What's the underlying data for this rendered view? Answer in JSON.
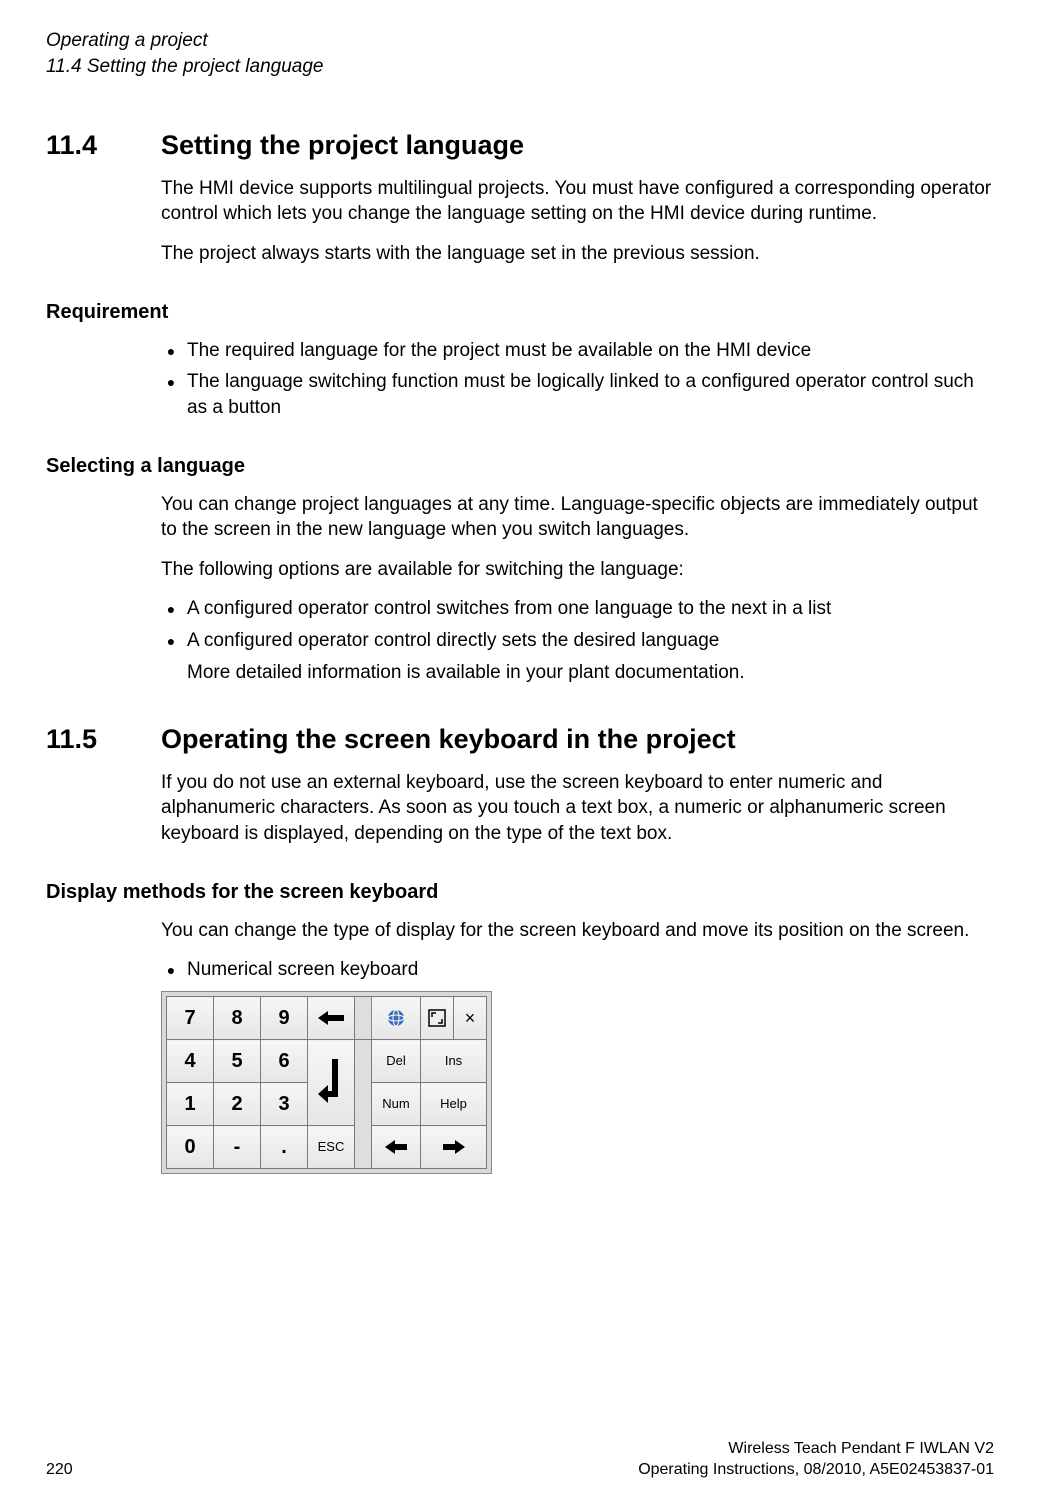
{
  "header": {
    "line1": "Operating a project",
    "line2": "11.4 Setting the project language"
  },
  "s114": {
    "num": "11.4",
    "title": "Setting the project language",
    "intro1": "The HMI device supports multilingual projects. You must have configured a corresponding operator control which lets you change the language setting on the HMI device during runtime.",
    "intro2": "The project always starts with the language set in the previous session.",
    "req_h": "Requirement",
    "req1": "The required language for the project must be available on the HMI device",
    "req2": "The language switching function must be logically linked to a configured operator control such as a button",
    "sel_h": "Selecting a language",
    "sel1": "You can change project languages at any time. Language-specific objects are immediately output to the screen in the new language when you switch languages.",
    "sel2": "The following options are available for switching the language:",
    "sel_b1": "A configured operator control switches from one language to the next in a list",
    "sel_b2": "A configured operator control directly sets the desired language",
    "sel_more": "More detailed information is available in your plant documentation."
  },
  "s115": {
    "num": "11.5",
    "title": "Operating the screen keyboard in the project",
    "intro": "If you do not use an external keyboard, use the screen keyboard to enter numeric and alphanumeric characters. As soon as you touch a text box, a numeric or alphanumeric screen keyboard is displayed, depending on the type of the text box.",
    "disp_h": "Display methods for the screen keyboard",
    "disp_p": "You can change the type of display for the screen keyboard and move its position on the screen.",
    "disp_b1": "Numerical screen keyboard"
  },
  "keyboard": {
    "r1": [
      "7",
      "8",
      "9",
      "←"
    ],
    "r2": [
      "4",
      "5",
      "6"
    ],
    "r3": [
      "1",
      "2",
      "3",
      "↵"
    ],
    "r4": [
      "0",
      "-",
      "."
    ],
    "side": {
      "tools": [
        "globe",
        "expand",
        "×"
      ],
      "row2": [
        "Del",
        "Ins"
      ],
      "row3": [
        "Num",
        "Help"
      ],
      "row4": [
        "ESC",
        "←",
        "→"
      ]
    }
  },
  "footer": {
    "page": "220",
    "prod": "Wireless Teach Pendant F IWLAN V2",
    "doc": "Operating Instructions, 08/2010, A5E02453837-01"
  }
}
